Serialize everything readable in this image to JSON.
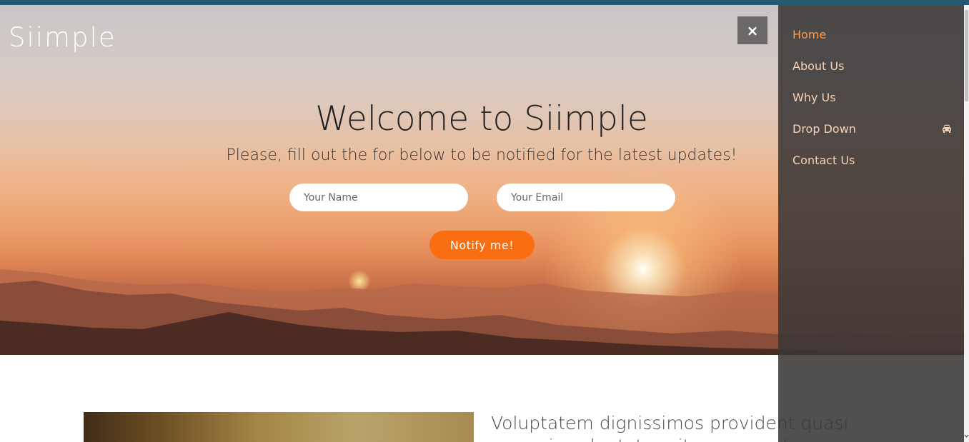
{
  "header": {
    "logo": "Siimple"
  },
  "hero": {
    "title": "Welcome to Siimple",
    "subtitle": "Please, fill out the for below to be notified for the latest updates!",
    "name_placeholder": "Your Name",
    "email_placeholder": "Your Email",
    "notify_label": "Notify me!"
  },
  "close_label": "×",
  "side_nav": {
    "items": [
      {
        "label": "Home",
        "active": true
      },
      {
        "label": "About Us"
      },
      {
        "label": "Why Us"
      },
      {
        "label": "Drop Down",
        "icon": "car-icon"
      },
      {
        "label": "Contact Us"
      }
    ]
  },
  "content": {
    "heading": "Voluptatem dignissimos provident quasi corporis voluptates sit assumenda"
  },
  "colors": {
    "top_bar": "#255a72",
    "accent": "#fa6e12",
    "nav_text": "#f7d2b4",
    "nav_active": "#fb9a55"
  }
}
